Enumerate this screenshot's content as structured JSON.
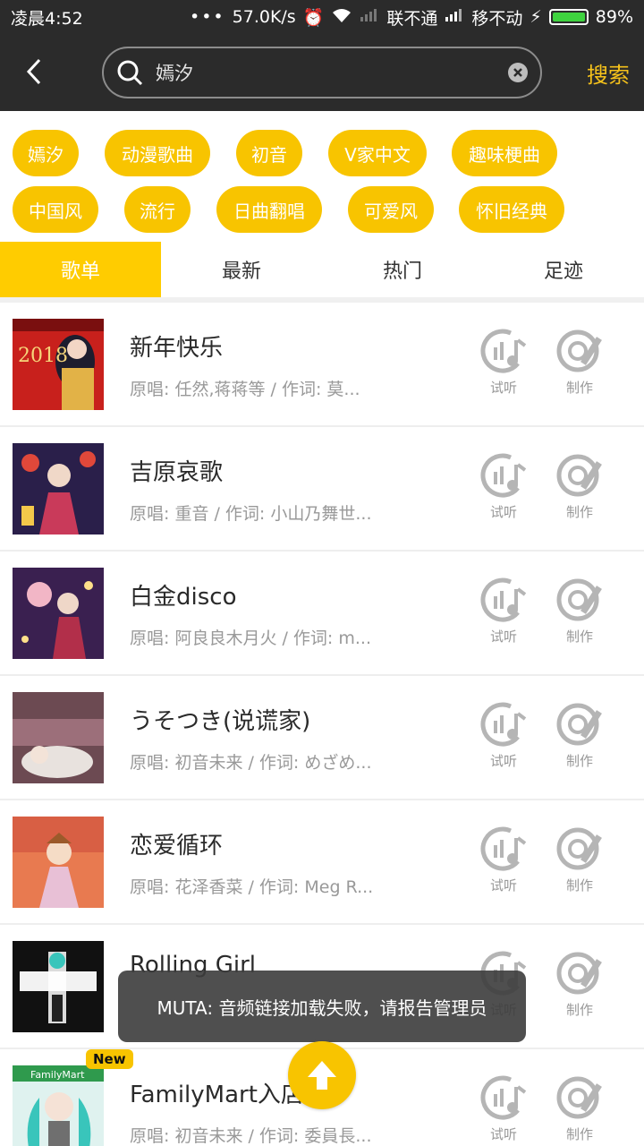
{
  "status_bar": {
    "time": "凌晨4:52",
    "speed": "57.0K/s",
    "carrier1": "联不通",
    "carrier2": "移不动",
    "battery": "89%"
  },
  "header": {
    "search_value": "嫣汐",
    "search_button": "搜索"
  },
  "tags": [
    "嫣汐",
    "动漫歌曲",
    "初音",
    "V家中文",
    "趣味梗曲",
    "中国风",
    "流行",
    "日曲翻唱",
    "可爱风",
    "怀旧经典"
  ],
  "tabs": [
    "歌单",
    "最新",
    "热门",
    "足迹"
  ],
  "actions": {
    "listen": "试听",
    "make": "制作"
  },
  "songs": [
    {
      "title": "新年快乐",
      "meta": "原唱: 任然,蒋蒋等 / 作词: 莫..."
    },
    {
      "title": "吉原哀歌",
      "meta": "原唱: 重音 / 作词: 小山乃舞世..."
    },
    {
      "title": "白金disco",
      "meta": "原唱: 阿良良木月火 / 作词: m..."
    },
    {
      "title": "うそつき(说谎家)",
      "meta": "原唱: 初音未来 / 作词: めざめ..."
    },
    {
      "title": "恋爱循环",
      "meta": "原唱: 花泽香菜 / 作词: Meg R..."
    },
    {
      "title": "Rolling Girl",
      "meta": ""
    },
    {
      "title": "FamilyMart入店音",
      "meta": "原唱: 初音未来 / 作词: 委員長..."
    }
  ],
  "badge_new": "New",
  "cover_text": {
    "year": "2018",
    "fm": "FamilyMart"
  },
  "toast": "MUTA: 音频链接加载失败，请报告管理员",
  "colors": {
    "accent": "#f8c400",
    "header_bg": "#2b2b2b",
    "search_accent": "#f6c21b"
  }
}
